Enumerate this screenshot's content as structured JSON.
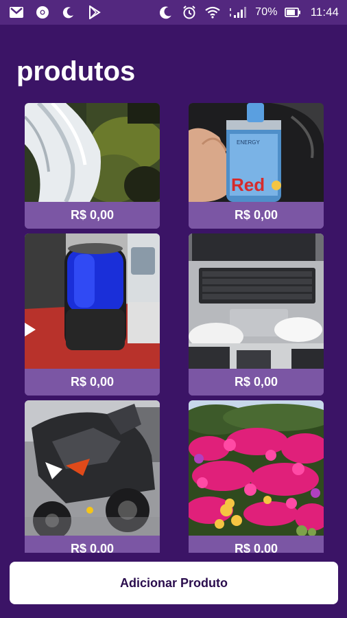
{
  "status_bar": {
    "battery": "70%",
    "time": "11:44",
    "icons": [
      "gmail-icon",
      "chrome-icon",
      "moon-icon",
      "play-store-icon",
      "moon-icon",
      "alarm-icon",
      "wifi-icon",
      "signal-icon",
      "battery-icon"
    ]
  },
  "page": {
    "title": "produtos",
    "add_button_label": "Adicionar Produto"
  },
  "products": [
    {
      "price": "R$ 0,00",
      "image": "waterfall"
    },
    {
      "price": "R$ 0,00",
      "image": "energy-drink-can"
    },
    {
      "price": "R$ 0,00",
      "image": "bluetooth-speaker"
    },
    {
      "price": "R$ 0,00",
      "image": "laptop"
    },
    {
      "price": "R$ 0,00",
      "image": "motorcycle"
    },
    {
      "price": "R$ 0,00",
      "image": "pink-flowers"
    }
  ],
  "colors": {
    "background": "#3b1466",
    "status_bar": "#53287f",
    "card_footer": "#7b56a4",
    "button": "#ffffff"
  }
}
